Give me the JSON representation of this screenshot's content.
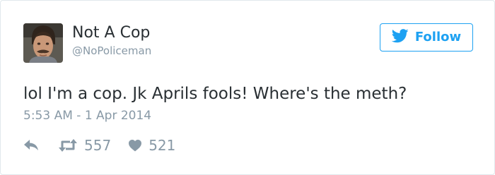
{
  "user": {
    "display_name": "Not A Cop",
    "handle": "@NoPoliceman",
    "avatar_icon": "profile-photo"
  },
  "follow_button": {
    "label": "Follow",
    "icon": "twitter-bird-icon",
    "accent_color": "#1da1f2"
  },
  "tweet": {
    "text": "lol I'm a cop. Jk Aprils fools! Where's the meth?",
    "timestamp": "5:53 AM - 1 Apr 2014"
  },
  "actions": {
    "reply": {
      "icon": "reply-icon"
    },
    "retweet": {
      "icon": "retweet-icon",
      "count": "557"
    },
    "like": {
      "icon": "heart-icon",
      "count": "521"
    }
  },
  "colors": {
    "text": "#292f33",
    "muted": "#8899a6",
    "border": "#e1e8ed"
  }
}
